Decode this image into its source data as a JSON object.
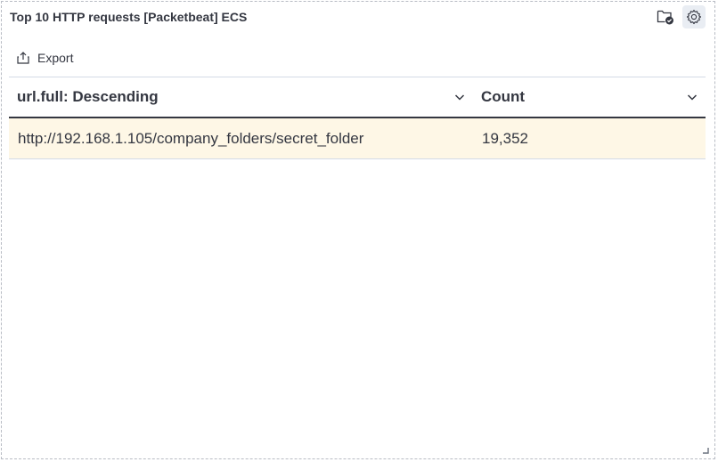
{
  "panel": {
    "title": "Top 10 HTTP requests [Packetbeat] ECS",
    "icons": {
      "folder": "folder-check-icon",
      "gear": "gear-icon"
    }
  },
  "toolbar": {
    "export_label": "Export",
    "export_icon": "export-icon"
  },
  "table": {
    "columns": [
      {
        "label": "url.full: Descending",
        "sort": "descending"
      },
      {
        "label": "Count"
      }
    ],
    "rows": [
      {
        "url": "http://192.168.1.105/company_folders/secret_folder",
        "count": "19,352"
      }
    ],
    "row_highlight_color": "#fef7e6"
  }
}
